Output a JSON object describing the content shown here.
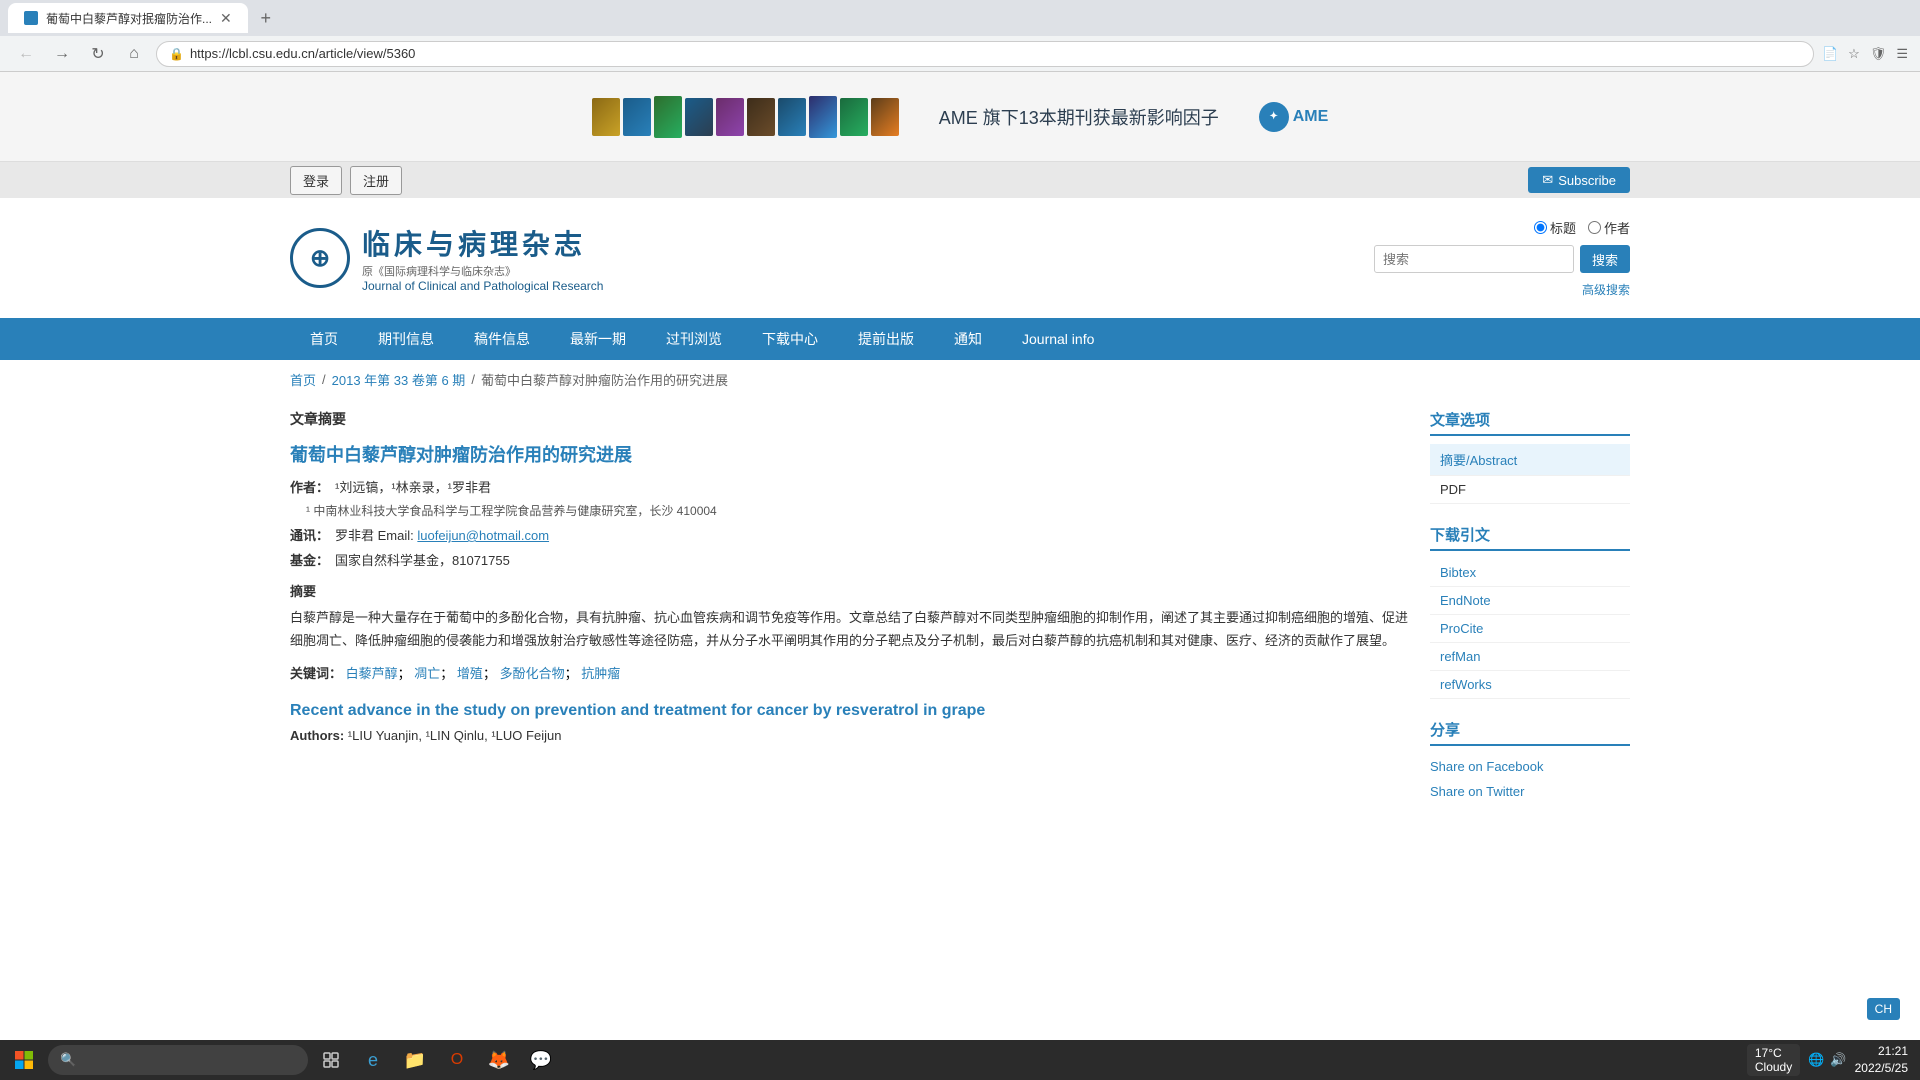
{
  "browser": {
    "tab_title": "葡萄中白藜芦醇对抿瘤防治作...",
    "url": "https://lcbl.csu.edu.cn/article/view/5360",
    "tab_add_icon": "+",
    "nav_back": "←",
    "nav_forward": "→",
    "nav_refresh": "↻",
    "nav_home": "⌂"
  },
  "banner": {
    "text": "AME 旗下13本期刊获最新影响因子",
    "logo": "AME"
  },
  "topbar": {
    "login": "登录",
    "register": "注册",
    "subscribe": "Subscribe"
  },
  "header": {
    "journal_title_cn": "临床与病理杂志",
    "journal_subtitle_cn": "原《国际病理科学与临床杂志》",
    "journal_title_en": "Journal of Clinical and Pathological Research",
    "search_radio_biaoti": "标题",
    "search_radio_zuozhe": "作者",
    "search_placeholder": "搜索",
    "search_button": "搜索",
    "advanced_search": "高级搜索"
  },
  "nav": {
    "items": [
      {
        "label": "首页",
        "active": false
      },
      {
        "label": "期刊信息",
        "active": false
      },
      {
        "label": "稿件信息",
        "active": false
      },
      {
        "label": "最新一期",
        "active": false
      },
      {
        "label": "过刊浏览",
        "active": false
      },
      {
        "label": "下载中心",
        "active": false
      },
      {
        "label": "提前出版",
        "active": false
      },
      {
        "label": "通知",
        "active": false
      },
      {
        "label": "Journal info",
        "active": false
      }
    ]
  },
  "breadcrumb": {
    "home": "首页",
    "issue": "2013 年第 33 卷第 6 期",
    "current": "葡萄中白藜芦醇对肿瘤防治作用的研究进展"
  },
  "article": {
    "section_label": "文章摘要",
    "title_cn": "葡萄中白藜芦醇对肿瘤防治作用的研究进展",
    "authors_label": "作者：",
    "authors": "¹刘远镐，¹林亲录，¹罗非君",
    "affiliation": "¹ 中南林业科技大学食品科学与工程学院食品营养与健康研究室，长沙 410004",
    "correspondence_label": "通讯：",
    "correspondence": "罗非君 Email: luofeijun@hotmail.com",
    "fund_label": "基金：",
    "fund": "国家自然科学基金，81071755",
    "abstract_label": "摘要",
    "abstract_text": "白藜芦醇是一种大量存在于葡萄中的多酚化合物，具有抗肿瘤、抗心血管疾病和调节免疫等作用。文章总结了白藜芦醇对不同类型肿瘤细胞的抑制作用，阐述了其主要通过抑制癌细胞的增殖、促进细胞凋亡、降低肿瘤细胞的侵袭能力和增强放射治疗敏感性等途径防癌，并从分子水平阐明其作用的分子靶点及分子机制，最后对白藜芦醇的抗癌机制和其对健康、医疗、经济的贡献作了展望。",
    "keywords_label": "关键词：",
    "keywords": [
      "白藜芦醇",
      "凋亡",
      "增殖",
      "多酚化合物",
      "抗肿瘤"
    ],
    "title_en": "Recent advance in the study on prevention and treatment for cancer by resveratrol in grape",
    "authors_en_label": "Authors:",
    "authors_en": "¹LIU Yuanjin, ¹LIN Qinlu, ¹LUO Feijun"
  },
  "sidebar": {
    "article_options_title": "文章选项",
    "abstract_label": "摘要/Abstract",
    "pdf_label": "PDF",
    "download_citation_title": "下载引文",
    "bibtex": "Bibtex",
    "endnote": "EndNote",
    "procite": "ProCite",
    "refman": "refMan",
    "refworks": "refWorks",
    "share_title": "分享",
    "share_facebook": "Share on Facebook",
    "share_twitter": "Share on Twitter"
  },
  "taskbar": {
    "weather_temp": "17°C",
    "weather_desc": "Cloudy",
    "time": "21:21",
    "date": "2022/5/25"
  }
}
